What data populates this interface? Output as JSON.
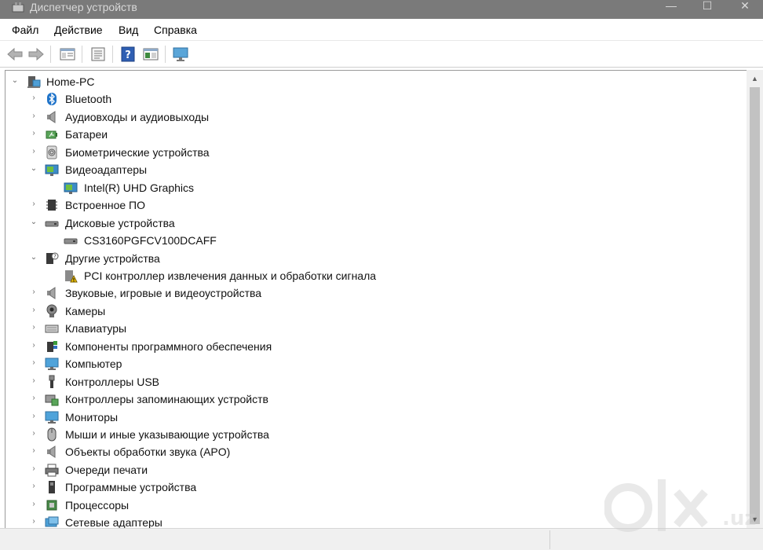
{
  "window": {
    "title": "Диспетчер устройств",
    "controls": [
      "—",
      "☐",
      "✕"
    ]
  },
  "menu": [
    "Файл",
    "Действие",
    "Вид",
    "Справка"
  ],
  "toolbar": [
    "back-icon",
    "forward-icon",
    "console-tree-icon",
    "properties-icon",
    "help-icon",
    "view-icon",
    "monitor-icon"
  ],
  "tree": {
    "root": {
      "label": "Home-PC",
      "icon": "computer-icon",
      "expanded": true
    },
    "items": [
      {
        "label": "Bluetooth",
        "icon": "bluetooth-icon",
        "level": 1,
        "expander": "collapsed"
      },
      {
        "label": "Аудиовходы и аудиовыходы",
        "icon": "speaker-icon",
        "level": 1,
        "expander": "collapsed"
      },
      {
        "label": "Батареи",
        "icon": "battery-icon",
        "level": 1,
        "expander": "collapsed"
      },
      {
        "label": "Биометрические устройства",
        "icon": "fingerprint-icon",
        "level": 1,
        "expander": "collapsed"
      },
      {
        "label": "Видеоадаптеры",
        "icon": "display-adapter-icon",
        "level": 1,
        "expander": "expanded"
      },
      {
        "label": "Intel(R) UHD Graphics",
        "icon": "display-adapter-icon",
        "level": 2,
        "expander": "none"
      },
      {
        "label": "Встроенное ПО",
        "icon": "firmware-icon",
        "level": 1,
        "expander": "collapsed"
      },
      {
        "label": "Дисковые устройства",
        "icon": "disk-drive-icon",
        "level": 1,
        "expander": "expanded"
      },
      {
        "label": "CS3160PGFCV100DCAFF",
        "icon": "disk-drive-icon",
        "level": 2,
        "expander": "none"
      },
      {
        "label": "Другие устройства",
        "icon": "unknown-device-icon",
        "level": 1,
        "expander": "expanded"
      },
      {
        "label": "PCI контроллер извлечения данных и обработки сигнала",
        "icon": "warning-device-icon",
        "level": 2,
        "expander": "none"
      },
      {
        "label": "Звуковые, игровые и видеоустройства",
        "icon": "speaker-icon",
        "level": 1,
        "expander": "collapsed"
      },
      {
        "label": "Камеры",
        "icon": "camera-icon",
        "level": 1,
        "expander": "collapsed"
      },
      {
        "label": "Клавиатуры",
        "icon": "keyboard-icon",
        "level": 1,
        "expander": "collapsed"
      },
      {
        "label": "Компоненты программного обеспечения",
        "icon": "software-component-icon",
        "level": 1,
        "expander": "collapsed"
      },
      {
        "label": "Компьютер",
        "icon": "monitor-icon",
        "level": 1,
        "expander": "collapsed"
      },
      {
        "label": "Контроллеры USB",
        "icon": "usb-icon",
        "level": 1,
        "expander": "collapsed"
      },
      {
        "label": "Контроллеры запоминающих устройств",
        "icon": "storage-controller-icon",
        "level": 1,
        "expander": "collapsed"
      },
      {
        "label": "Мониторы",
        "icon": "monitor-icon",
        "level": 1,
        "expander": "collapsed"
      },
      {
        "label": "Мыши и иные указывающие устройства",
        "icon": "mouse-icon",
        "level": 1,
        "expander": "collapsed"
      },
      {
        "label": "Объекты обработки звука (APO)",
        "icon": "speaker-icon",
        "level": 1,
        "expander": "collapsed"
      },
      {
        "label": "Очереди печати",
        "icon": "printer-icon",
        "level": 1,
        "expander": "collapsed"
      },
      {
        "label": "Программные устройства",
        "icon": "software-device-icon",
        "level": 1,
        "expander": "collapsed"
      },
      {
        "label": "Процессоры",
        "icon": "processor-icon",
        "level": 1,
        "expander": "collapsed"
      },
      {
        "label": "Сетевые адаптеры",
        "icon": "network-adapter-icon",
        "level": 1,
        "expander": "collapsed"
      }
    ]
  },
  "watermark": "olx.uz",
  "colors": {
    "titlebar": "#7a7a7a",
    "selection": "#cce8ff",
    "accent": "#0078d7"
  }
}
